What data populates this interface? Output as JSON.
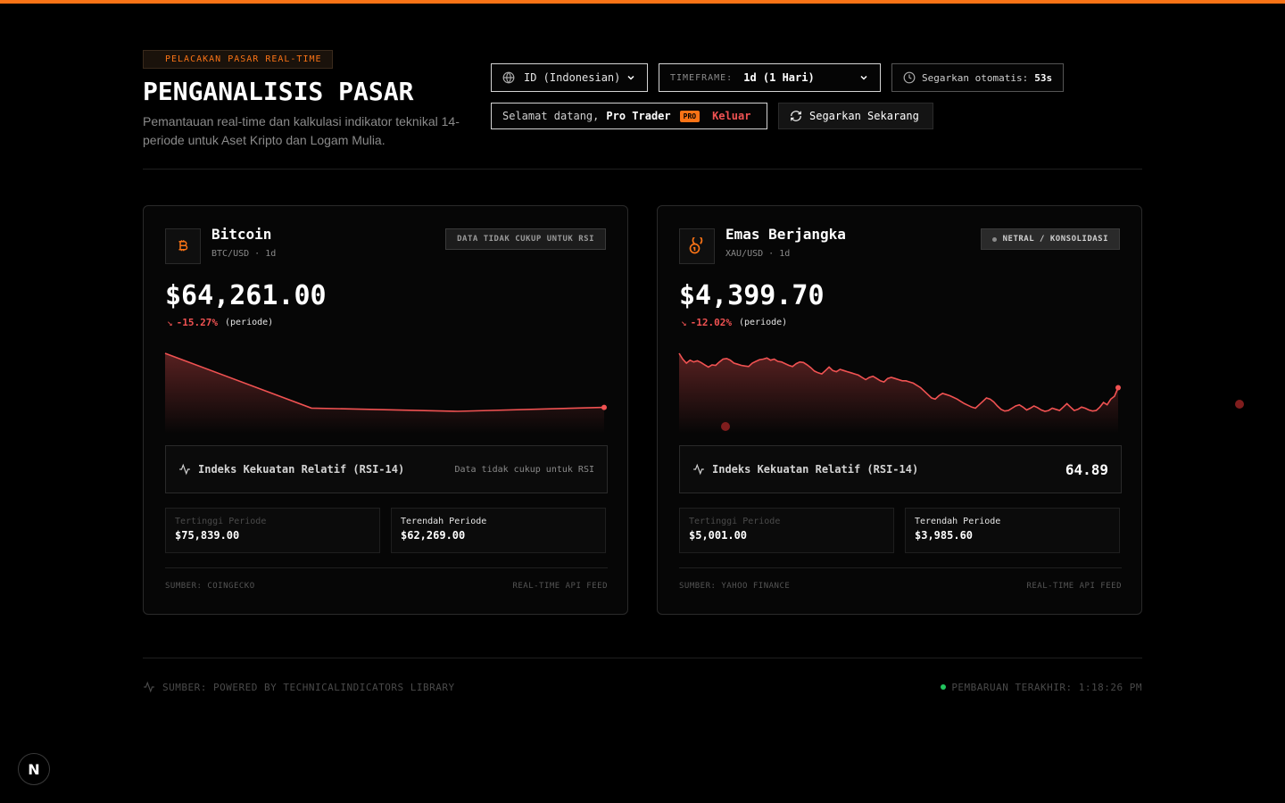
{
  "header": {
    "tag": "PELACAKAN PASAR REAL-TIME",
    "title": "PENGANALISIS PASAR",
    "subtitle": "Pemantauan real-time dan kalkulasi indikator teknikal 14-periode untuk Aset Kripto dan Logam Mulia."
  },
  "controls": {
    "language": "ID (Indonesian)",
    "timeframe_label": "TIMEFRAME:",
    "timeframe_value": "1d (1 Hari)",
    "auto_refresh_label": "Segarkan otomatis:",
    "auto_refresh_value": "53s",
    "welcome": "Selamat datang,",
    "user": "Pro Trader",
    "pro_badge": "PRO",
    "logout": "Keluar",
    "refresh_now": "Segarkan Sekarang"
  },
  "cards": [
    {
      "name": "Bitcoin",
      "pair": "BTC/USD · 1d",
      "icon": "bitcoin-icon",
      "badge": "DATA TIDAK CUKUP UNTUK RSI",
      "price": "$64,261.00",
      "change": "-15.27%",
      "change_note": "(periode)",
      "rsi_label": "Indeks Kekuatan Relatif (RSI-14)",
      "rsi_value": "Data tidak cukup untuk RSI",
      "high_label": "Tertinggi Periode",
      "high_value": "$75,839.00",
      "low_label": "Terendah Periode",
      "low_value": "$62,269.00",
      "source": "SUMBER: COINGECKO",
      "feed": "REAL-TIME API FEED",
      "series": [
        75839,
        67400,
        66900,
        67500
      ]
    },
    {
      "name": "Emas Berjangka",
      "pair": "XAU/USD · 1d",
      "icon": "gold-coins-icon",
      "badge": "NETRAL / KONSOLIDASI",
      "price": "$4,399.70",
      "change": "-12.02%",
      "change_note": "(periode)",
      "rsi_label": "Indeks Kekuatan Relatif (RSI-14)",
      "rsi_value": "64.89",
      "high_label": "Tertinggi Periode",
      "high_value": "$5,001.00",
      "low_label": "Terendah Periode",
      "low_value": "$3,985.60",
      "source": "SUMBER: YAHOO FINANCE",
      "feed": "REAL-TIME API FEED",
      "series": [
        5001,
        4900,
        4830,
        4880,
        4850,
        4870,
        4840,
        4800,
        4760,
        4800,
        4790,
        4850,
        4900,
        4910,
        4880,
        4830,
        4810,
        4790,
        4780,
        4770,
        4830,
        4860,
        4890,
        4900,
        4920,
        4880,
        4900,
        4860,
        4850,
        4820,
        4790,
        4770,
        4820,
        4850,
        4840,
        4800,
        4750,
        4690,
        4660,
        4640,
        4700,
        4760,
        4700,
        4680,
        4720,
        4700,
        4680,
        4660,
        4640,
        4620,
        4580,
        4540,
        4580,
        4600,
        4560,
        4520,
        4500,
        4560,
        4580,
        4560,
        4540,
        4520,
        4520,
        4500,
        4480,
        4440,
        4400,
        4340,
        4280,
        4220,
        4200,
        4260,
        4300,
        4280,
        4260,
        4230,
        4200,
        4160,
        4120,
        4090,
        4060,
        4040,
        4100,
        4160,
        4220,
        4200,
        4150,
        4080,
        4020,
        3990,
        4000,
        4040,
        4080,
        4100,
        4060,
        4010,
        4040,
        4080,
        4050,
        4010,
        3986,
        4000,
        4040,
        4020,
        4000,
        4060,
        4120,
        4060,
        4000,
        4020,
        4060,
        4040,
        4010,
        3990,
        4000,
        4060,
        4140,
        4100,
        4200,
        4250,
        4400
      ]
    }
  ],
  "footer": {
    "source": "SUMBER: POWERED BY TECHNICALINDICATORS LIBRARY",
    "updated": "PEMBARUAN TERAKHIR: 1:18:26 PM"
  },
  "colors": {
    "accent": "#f97316",
    "negative": "#f05252",
    "positive": "#22c55e"
  }
}
